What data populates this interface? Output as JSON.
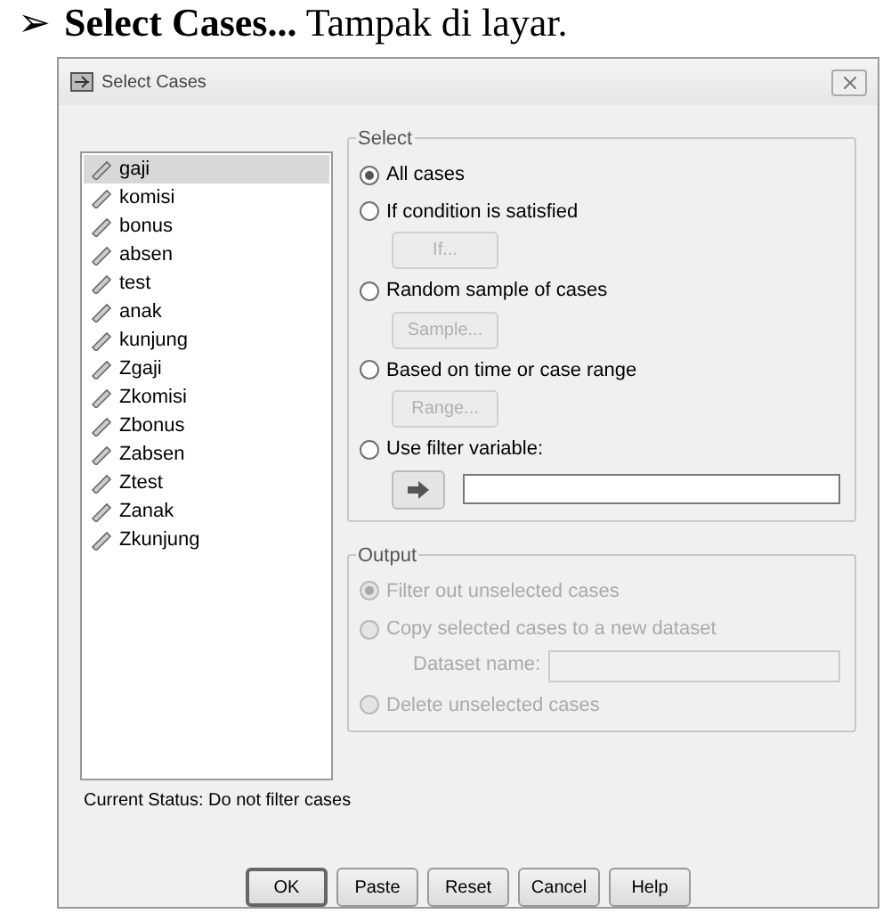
{
  "heading": {
    "marker": "➢",
    "text": "**Select Cases...** Tampak di layar."
  },
  "window": {
    "title": "Select Cases"
  },
  "variables": [
    {
      "name": "gaji",
      "selected": true
    },
    {
      "name": "komisi",
      "selected": false
    },
    {
      "name": "bonus",
      "selected": false
    },
    {
      "name": "absen",
      "selected": false
    },
    {
      "name": "test",
      "selected": false
    },
    {
      "name": "anak",
      "selected": false
    },
    {
      "name": "kunjung",
      "selected": false
    },
    {
      "name": "Zgaji",
      "selected": false
    },
    {
      "name": "Zkomisi",
      "selected": false
    },
    {
      "name": "Zbonus",
      "selected": false
    },
    {
      "name": "Zabsen",
      "selected": false
    },
    {
      "name": "Ztest",
      "selected": false
    },
    {
      "name": "Zanak",
      "selected": false
    },
    {
      "name": "Zkunjung",
      "selected": false
    }
  ],
  "select_group": {
    "title": "Select",
    "options": [
      {
        "kind": "plain",
        "label": "All cases",
        "selected": true
      },
      {
        "kind": "button",
        "label": "If condition is satisfied",
        "selected": false,
        "button": {
          "label": "If...",
          "disabled": true
        }
      },
      {
        "kind": "button",
        "label": "Random sample of cases",
        "selected": false,
        "button": {
          "label": "Sample...",
          "disabled": true
        }
      },
      {
        "kind": "button",
        "label": "Based on time or case range",
        "selected": false,
        "button": {
          "label": "Range...",
          "disabled": true
        }
      },
      {
        "kind": "filter",
        "label": "Use filter variable:",
        "selected": false
      }
    ]
  },
  "output_group": {
    "title": "Output",
    "disabled": true,
    "options": [
      {
        "kind": "plain",
        "label": "Filter out unselected cases",
        "selected": true
      },
      {
        "kind": "dataset",
        "label": "Copy selected cases to a new dataset",
        "selected": false,
        "field_label": "Dataset name:"
      },
      {
        "kind": "plain",
        "label": "Delete unselected cases",
        "selected": false
      }
    ]
  },
  "status": "Current Status: Do not filter cases",
  "buttons": [
    {
      "label": "OK",
      "default": true
    },
    {
      "label": "Paste",
      "default": false
    },
    {
      "label": "Reset",
      "default": false
    },
    {
      "label": "Cancel",
      "default": false
    },
    {
      "label": "Help",
      "default": false
    }
  ]
}
